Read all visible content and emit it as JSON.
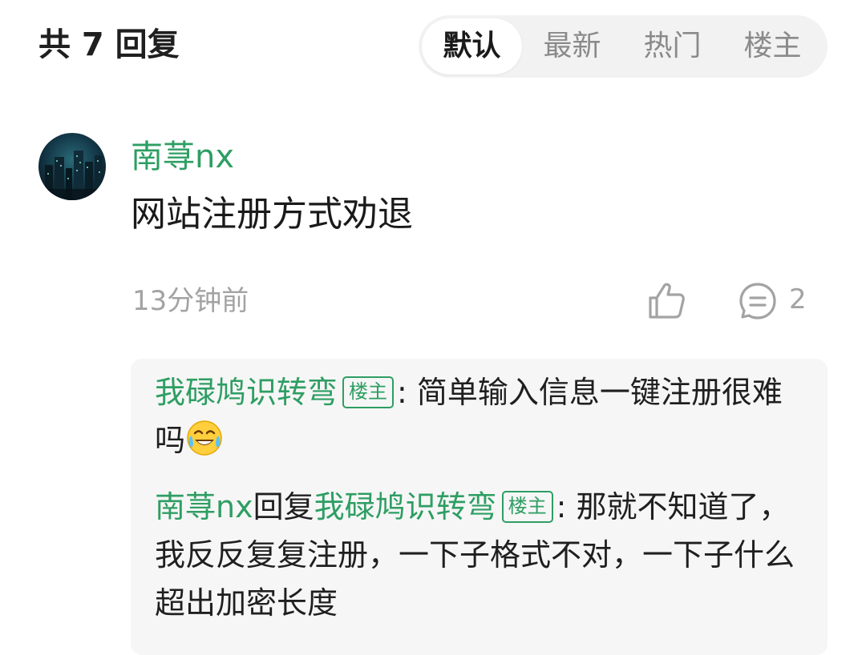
{
  "header": {
    "reply_count": "共 7 回复",
    "tabs": [
      {
        "label": "默认",
        "active": true
      },
      {
        "label": "最新",
        "active": false
      },
      {
        "label": "热门",
        "active": false
      },
      {
        "label": "楼主",
        "active": false
      }
    ]
  },
  "comment": {
    "author": "南荨nx",
    "text": "网站注册方式劝退",
    "time": "13分钟前",
    "like_icon": "thumbs-up-icon",
    "comment_icon": "comment-icon",
    "reply_count": "2",
    "replies": [
      {
        "author": "我碌鸠识转弯",
        "badge": "楼主",
        "separator": ":",
        "text": "简单输入信息一键注册很难吗",
        "emoji": "laugh-cry-emoji"
      },
      {
        "author": "南荨nx",
        "verb": "回复",
        "target": "我碌鸠识转弯",
        "badge": "楼主",
        "separator": ":",
        "text": "那就不知道了，我反反复复注册，一下子格式不对，一下子什么超出加密长度"
      }
    ]
  },
  "colors": {
    "accent_green": "#2e9e63",
    "muted_gray": "#a3a3a3",
    "reply_bg": "#f6f6f6"
  }
}
